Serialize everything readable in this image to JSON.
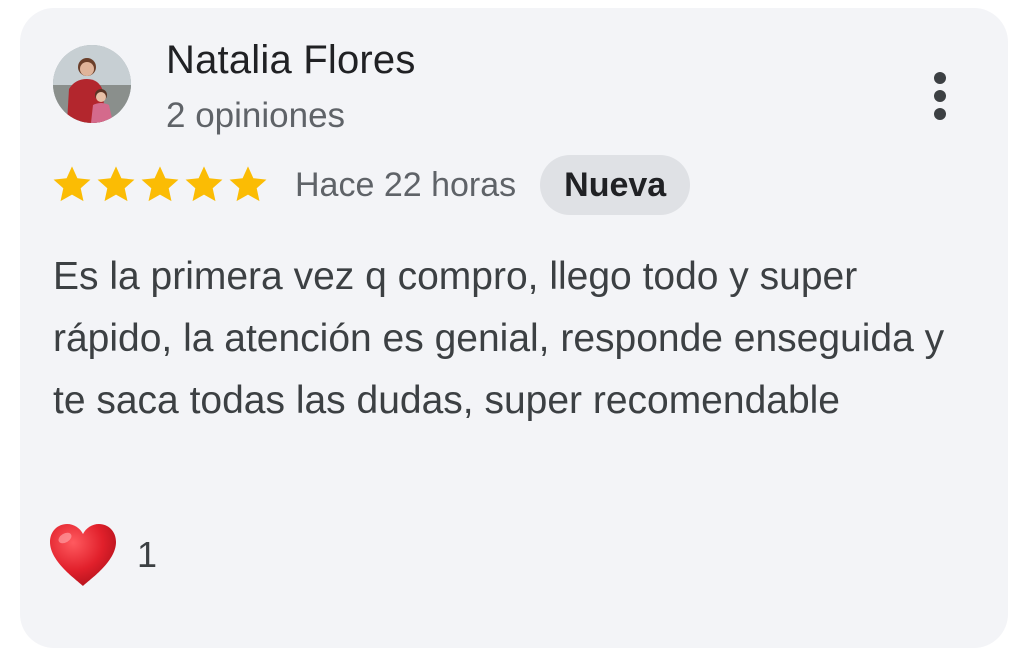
{
  "review": {
    "reviewer_name": "Natalia Flores",
    "review_count": "2 opiniones",
    "rating": 5,
    "rating_max": 5,
    "time_ago": "Hace 22 horas",
    "badge": "Nueva",
    "text": "Es la primera vez q compro, llego todo y super rápido, la atención es genial, responde enseguida y te saca todas las dudas, super recomendable",
    "reaction": {
      "icon": "heart-icon",
      "count": "1"
    }
  },
  "icons": {
    "more": "more-vert-icon",
    "star": "star-icon"
  },
  "colors": {
    "star": "#fbbc04",
    "card_background": "#f3f4f7",
    "badge_background": "#dfe1e5",
    "heart": "#e1202b"
  }
}
